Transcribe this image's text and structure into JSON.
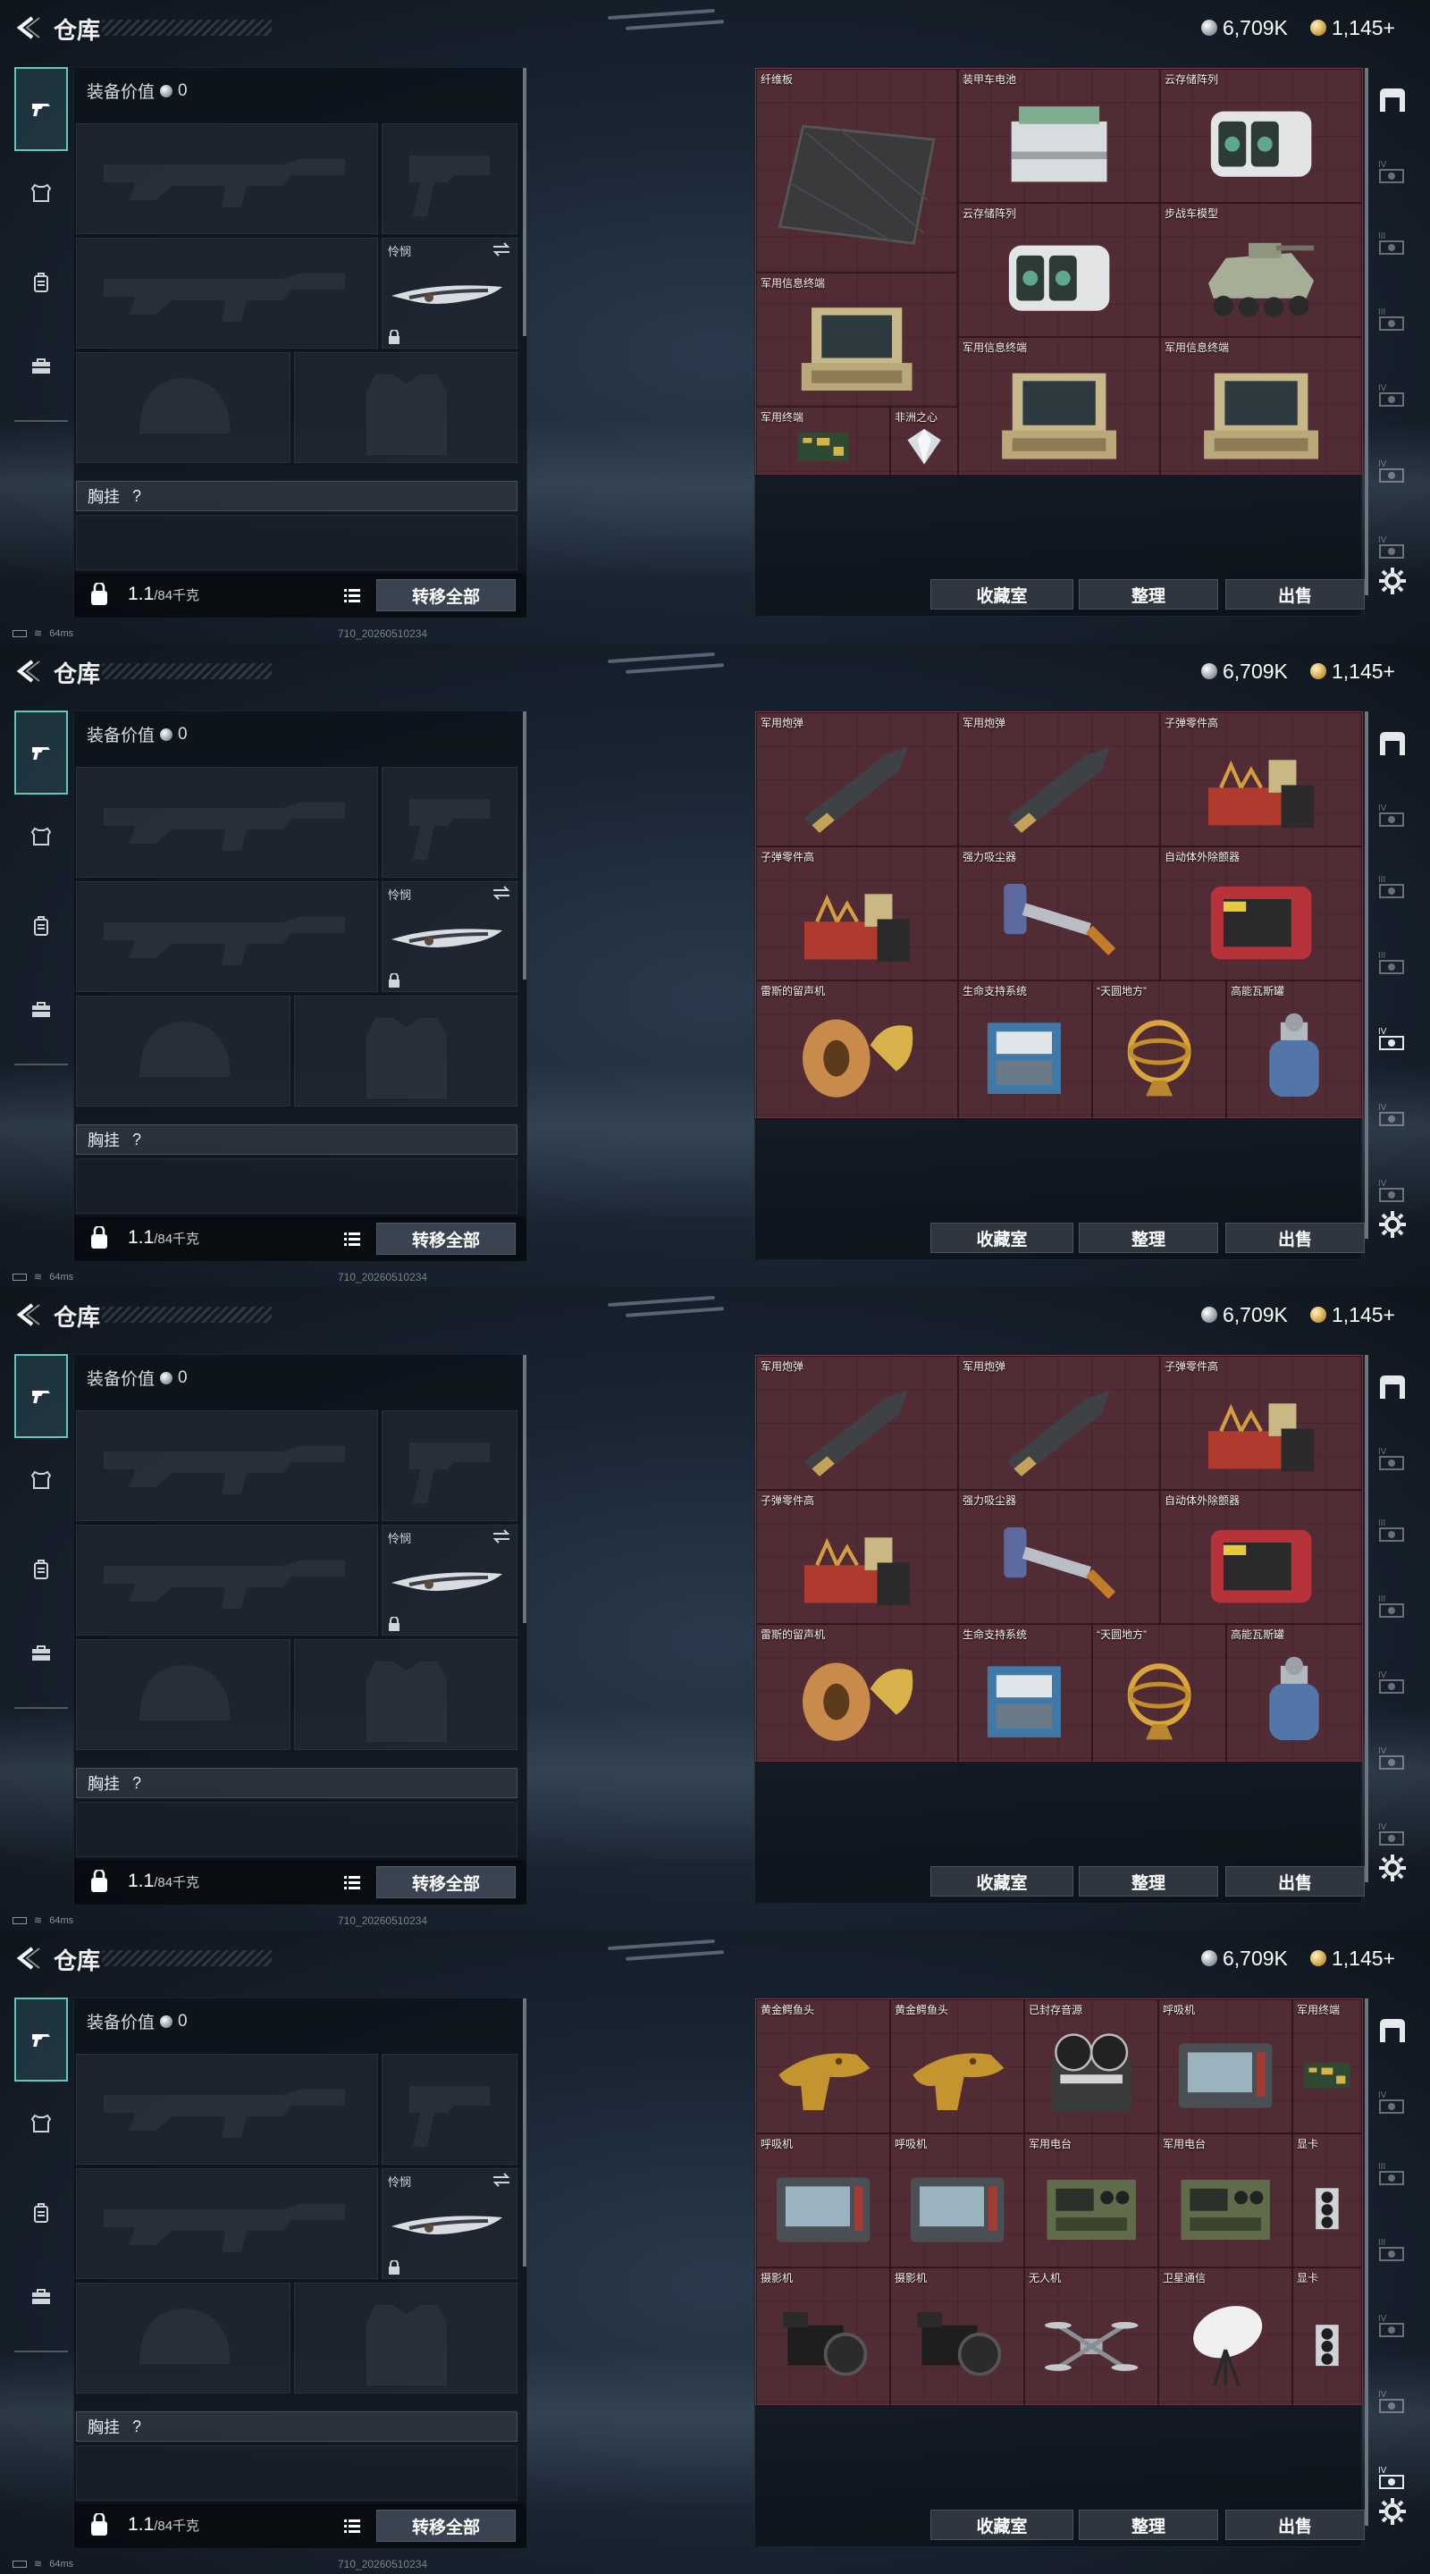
{
  "page": {
    "title": "仓库",
    "silver": "6,709K",
    "gold": "1,145+"
  },
  "equipment": {
    "value_label": "装备价值",
    "value": "0",
    "knife_label": "怜悯",
    "chest_label": "胸挂",
    "chest_q": "?",
    "weight": "1.1",
    "capacity": "/84千克",
    "transfer_label": "转移全部"
  },
  "storage": {
    "collection_label": "收藏室",
    "sort_label": "整理",
    "sell_label": "出售"
  },
  "status": {
    "ping": "64ms",
    "build": "710_20260510234"
  },
  "icons": {
    "nav": [
      "pistol-icon",
      "armor-icon",
      "backpack-icon",
      "briefcase-icon"
    ],
    "rail": [
      "safe-icon",
      "tier-iv-icon",
      "tier-iii-icon",
      "tier-iii-icon",
      "tier-iv-icon",
      "tier-iv-icon",
      "tier-iv-icon"
    ]
  },
  "colors": {
    "accent": "#5bc8c2",
    "grid": "#4a2b33"
  },
  "frames": [
    {
      "items": [
        {
          "name": "纤维板",
          "icon": "fiber-board"
        },
        {
          "name": "装甲车电池",
          "icon": "armored-battery"
        },
        {
          "name": "云存储阵列",
          "icon": "cloud-storage"
        },
        {
          "name": "云存储阵列",
          "icon": "cloud-storage"
        },
        {
          "name": "步战车模型",
          "icon": "ifv-model"
        },
        {
          "name": "军用信息终端",
          "icon": "military-terminal"
        },
        {
          "name": "军用信息终端",
          "icon": "military-terminal"
        },
        {
          "name": "军用信息终端",
          "icon": "military-terminal"
        },
        {
          "name": "军用终端",
          "icon": "circuit-board"
        },
        {
          "name": "非洲之心",
          "icon": "diamond"
        }
      ]
    },
    {
      "items": [
        {
          "name": "军用炮弹",
          "icon": "artillery-shell"
        },
        {
          "name": "军用炮弹",
          "icon": "artillery-shell"
        },
        {
          "name": "子弹零件高",
          "icon": "ammo-parts"
        },
        {
          "name": "子弹零件高",
          "icon": "ammo-parts"
        },
        {
          "name": "强力吸尘器",
          "icon": "vacuum"
        },
        {
          "name": "自动体外除颤器",
          "icon": "defibrillator"
        },
        {
          "name": "雷斯的留声机",
          "icon": "gramophone"
        },
        {
          "name": "生命支持系统",
          "icon": "life-support"
        },
        {
          "name": "“天圆地方”",
          "icon": "armillary"
        },
        {
          "name": "高能瓦斯罐",
          "icon": "gas-canister"
        }
      ]
    },
    {
      "items": [
        {
          "name": "军用炮弹",
          "icon": "artillery-shell"
        },
        {
          "name": "军用炮弹",
          "icon": "artillery-shell"
        },
        {
          "name": "子弹零件高",
          "icon": "ammo-parts"
        },
        {
          "name": "子弹零件高",
          "icon": "ammo-parts"
        },
        {
          "name": "强力吸尘器",
          "icon": "vacuum"
        },
        {
          "name": "自动体外除颤器",
          "icon": "defibrillator"
        },
        {
          "name": "雷斯的留声机",
          "icon": "gramophone"
        },
        {
          "name": "生命支持系统",
          "icon": "life-support"
        },
        {
          "name": "“天圆地方”",
          "icon": "armillary"
        },
        {
          "name": "高能瓦斯罐",
          "icon": "gas-canister"
        }
      ]
    },
    {
      "items": [
        {
          "name": "黄金鳄鱼头",
          "icon": "gold-croc-head"
        },
        {
          "name": "黄金鳄鱼头",
          "icon": "gold-croc-head"
        },
        {
          "name": "已封存音源",
          "icon": "reel-recorder"
        },
        {
          "name": "呼吸机",
          "icon": "ventilator"
        },
        {
          "name": "军用终端",
          "icon": "circuit-board"
        },
        {
          "name": "呼吸机",
          "icon": "ventilator"
        },
        {
          "name": "呼吸机",
          "icon": "ventilator"
        },
        {
          "name": "军用电台",
          "icon": "radio"
        },
        {
          "name": "军用电台",
          "icon": "radio"
        },
        {
          "name": "显卡",
          "icon": "graphics-card"
        },
        {
          "name": "摄影机",
          "icon": "camera"
        },
        {
          "name": "摄影机",
          "icon": "camera"
        },
        {
          "name": "无人机",
          "icon": "drone"
        },
        {
          "name": "卫星通信",
          "icon": "satellite-dish"
        },
        {
          "name": "显卡",
          "icon": "graphics-card"
        }
      ]
    }
  ]
}
